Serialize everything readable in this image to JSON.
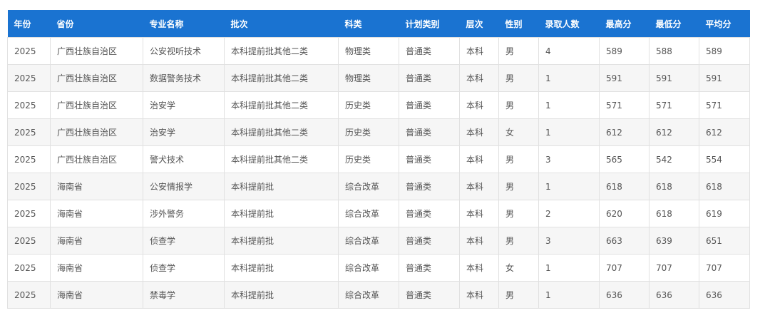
{
  "table": {
    "headers": [
      "年份",
      "省份",
      "专业名称",
      "批次",
      "科类",
      "计划类别",
      "层次",
      "性别",
      "录取人数",
      "最高分",
      "最低分",
      "平均分"
    ],
    "rows": [
      [
        "2025",
        "广西壮族自治区",
        "公安视听技术",
        "本科提前批其他二类",
        "物理类",
        "普通类",
        "本科",
        "男",
        "4",
        "589",
        "588",
        "589"
      ],
      [
        "2025",
        "广西壮族自治区",
        "数据警务技术",
        "本科提前批其他二类",
        "物理类",
        "普通类",
        "本科",
        "男",
        "1",
        "591",
        "591",
        "591"
      ],
      [
        "2025",
        "广西壮族自治区",
        "治安学",
        "本科提前批其他二类",
        "历史类",
        "普通类",
        "本科",
        "男",
        "1",
        "571",
        "571",
        "571"
      ],
      [
        "2025",
        "广西壮族自治区",
        "治安学",
        "本科提前批其他二类",
        "历史类",
        "普通类",
        "本科",
        "女",
        "1",
        "612",
        "612",
        "612"
      ],
      [
        "2025",
        "广西壮族自治区",
        "警犬技术",
        "本科提前批其他二类",
        "历史类",
        "普通类",
        "本科",
        "男",
        "3",
        "565",
        "542",
        "554"
      ],
      [
        "2025",
        "海南省",
        "公安情报学",
        "本科提前批",
        "综合改革",
        "普通类",
        "本科",
        "男",
        "1",
        "618",
        "618",
        "618"
      ],
      [
        "2025",
        "海南省",
        "涉外警务",
        "本科提前批",
        "综合改革",
        "普通类",
        "本科",
        "男",
        "2",
        "620",
        "618",
        "619"
      ],
      [
        "2025",
        "海南省",
        "侦查学",
        "本科提前批",
        "综合改革",
        "普通类",
        "本科",
        "男",
        "3",
        "663",
        "639",
        "651"
      ],
      [
        "2025",
        "海南省",
        "侦查学",
        "本科提前批",
        "综合改革",
        "普通类",
        "本科",
        "女",
        "1",
        "707",
        "707",
        "707"
      ],
      [
        "2025",
        "海南省",
        "禁毒学",
        "本科提前批",
        "综合改革",
        "普通类",
        "本科",
        "男",
        "1",
        "636",
        "636",
        "636"
      ]
    ]
  },
  "colors": {
    "header_bg": "#1a73d1",
    "header_text": "#ffffff",
    "cell_text": "#555555",
    "row_alt_bg": "#f6f6f6",
    "border": "#e1e1e1"
  }
}
